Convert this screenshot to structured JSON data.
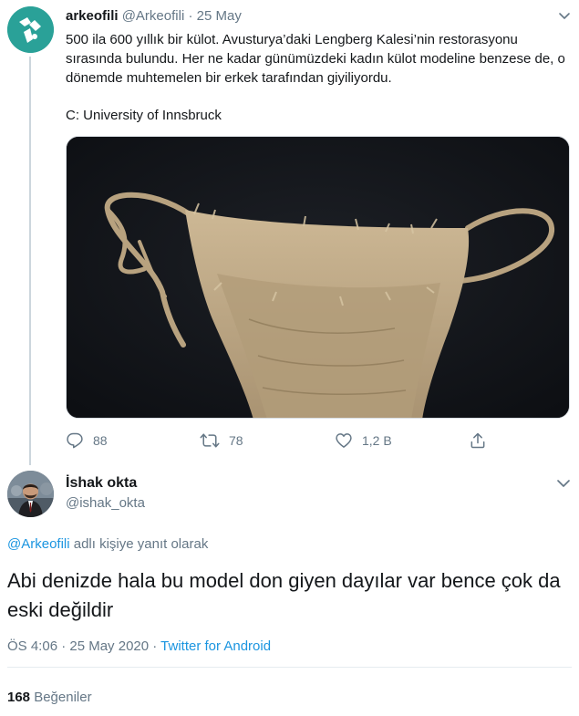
{
  "parent_tweet": {
    "display_name": "arkeofili",
    "handle": "@Arkeofili",
    "separator": "·",
    "date": "25 May",
    "text": "500 ila 600 yıllık bir külot. Avusturya’daki Lengberg Kalesi’nin restorasyonu sırasında bulundu. Her ne kadar günümüzdeki kadın külot modeline benzese de, o dönemde muhtemelen bir erkek tarafından giyiliyordu.",
    "credit": "C: University of Innsbruck",
    "stats": {
      "replies": "88",
      "retweets": "78",
      "likes": "1,2 B"
    },
    "avatar_color": "#2aa198"
  },
  "reply_tweet": {
    "display_name": "İshak okta",
    "handle": "@ishak_okta",
    "reply_to_mention": "@Arkeofili",
    "reply_to_suffix": "adlı kişiye yanıt olarak",
    "text": "Abi denizde hala bu model don giyen dayılar var bence çok da eski değildir",
    "time": "ÖS 4:06 · 25 May 2020 ·",
    "source": "Twitter for Android",
    "likes_count": "168",
    "likes_label": "Beğeniler"
  },
  "colors": {
    "link": "#1b95e0",
    "muted": "#657786",
    "text": "#14171a"
  },
  "icons": [
    "chevron-down-icon",
    "reply-icon",
    "retweet-icon",
    "like-icon",
    "share-icon"
  ]
}
